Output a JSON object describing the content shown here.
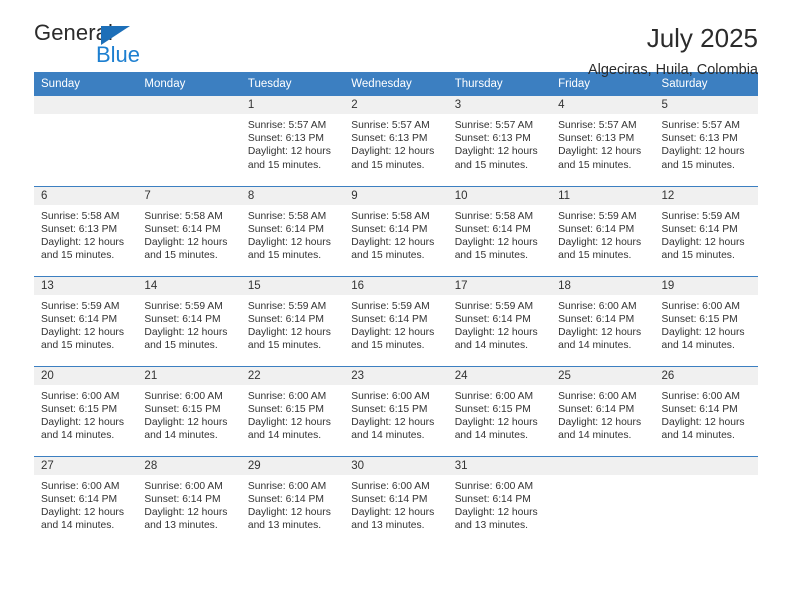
{
  "brand": {
    "name_top": "General",
    "name_bottom": "Blue",
    "triangle_color": "#1d6fb8",
    "blue_color": "#1d7fd0"
  },
  "header": {
    "month_title": "July 2025",
    "location": "Algeciras, Huila, Colombia"
  },
  "theme": {
    "header_blue": "#3c7fc1",
    "daynum_band": "#f0f0f0",
    "text": "#333333"
  },
  "weekdays": [
    "Sunday",
    "Monday",
    "Tuesday",
    "Wednesday",
    "Thursday",
    "Friday",
    "Saturday"
  ],
  "labels": {
    "sunrise_prefix": "Sunrise:",
    "sunset_prefix": "Sunset:",
    "daylight_prefix": "Daylight:"
  },
  "weeks": [
    [
      {
        "day": "",
        "blank": true
      },
      {
        "day": "",
        "blank": true
      },
      {
        "day": "1",
        "sunrise": "Sunrise: 5:57 AM",
        "sunset": "Sunset: 6:13 PM",
        "daylight1": "Daylight: 12 hours",
        "daylight2": "and 15 minutes."
      },
      {
        "day": "2",
        "sunrise": "Sunrise: 5:57 AM",
        "sunset": "Sunset: 6:13 PM",
        "daylight1": "Daylight: 12 hours",
        "daylight2": "and 15 minutes."
      },
      {
        "day": "3",
        "sunrise": "Sunrise: 5:57 AM",
        "sunset": "Sunset: 6:13 PM",
        "daylight1": "Daylight: 12 hours",
        "daylight2": "and 15 minutes."
      },
      {
        "day": "4",
        "sunrise": "Sunrise: 5:57 AM",
        "sunset": "Sunset: 6:13 PM",
        "daylight1": "Daylight: 12 hours",
        "daylight2": "and 15 minutes."
      },
      {
        "day": "5",
        "sunrise": "Sunrise: 5:57 AM",
        "sunset": "Sunset: 6:13 PM",
        "daylight1": "Daylight: 12 hours",
        "daylight2": "and 15 minutes."
      }
    ],
    [
      {
        "day": "6",
        "sunrise": "Sunrise: 5:58 AM",
        "sunset": "Sunset: 6:13 PM",
        "daylight1": "Daylight: 12 hours",
        "daylight2": "and 15 minutes."
      },
      {
        "day": "7",
        "sunrise": "Sunrise: 5:58 AM",
        "sunset": "Sunset: 6:14 PM",
        "daylight1": "Daylight: 12 hours",
        "daylight2": "and 15 minutes."
      },
      {
        "day": "8",
        "sunrise": "Sunrise: 5:58 AM",
        "sunset": "Sunset: 6:14 PM",
        "daylight1": "Daylight: 12 hours",
        "daylight2": "and 15 minutes."
      },
      {
        "day": "9",
        "sunrise": "Sunrise: 5:58 AM",
        "sunset": "Sunset: 6:14 PM",
        "daylight1": "Daylight: 12 hours",
        "daylight2": "and 15 minutes."
      },
      {
        "day": "10",
        "sunrise": "Sunrise: 5:58 AM",
        "sunset": "Sunset: 6:14 PM",
        "daylight1": "Daylight: 12 hours",
        "daylight2": "and 15 minutes."
      },
      {
        "day": "11",
        "sunrise": "Sunrise: 5:59 AM",
        "sunset": "Sunset: 6:14 PM",
        "daylight1": "Daylight: 12 hours",
        "daylight2": "and 15 minutes."
      },
      {
        "day": "12",
        "sunrise": "Sunrise: 5:59 AM",
        "sunset": "Sunset: 6:14 PM",
        "daylight1": "Daylight: 12 hours",
        "daylight2": "and 15 minutes."
      }
    ],
    [
      {
        "day": "13",
        "sunrise": "Sunrise: 5:59 AM",
        "sunset": "Sunset: 6:14 PM",
        "daylight1": "Daylight: 12 hours",
        "daylight2": "and 15 minutes."
      },
      {
        "day": "14",
        "sunrise": "Sunrise: 5:59 AM",
        "sunset": "Sunset: 6:14 PM",
        "daylight1": "Daylight: 12 hours",
        "daylight2": "and 15 minutes."
      },
      {
        "day": "15",
        "sunrise": "Sunrise: 5:59 AM",
        "sunset": "Sunset: 6:14 PM",
        "daylight1": "Daylight: 12 hours",
        "daylight2": "and 15 minutes."
      },
      {
        "day": "16",
        "sunrise": "Sunrise: 5:59 AM",
        "sunset": "Sunset: 6:14 PM",
        "daylight1": "Daylight: 12 hours",
        "daylight2": "and 15 minutes."
      },
      {
        "day": "17",
        "sunrise": "Sunrise: 5:59 AM",
        "sunset": "Sunset: 6:14 PM",
        "daylight1": "Daylight: 12 hours",
        "daylight2": "and 14 minutes."
      },
      {
        "day": "18",
        "sunrise": "Sunrise: 6:00 AM",
        "sunset": "Sunset: 6:14 PM",
        "daylight1": "Daylight: 12 hours",
        "daylight2": "and 14 minutes."
      },
      {
        "day": "19",
        "sunrise": "Sunrise: 6:00 AM",
        "sunset": "Sunset: 6:15 PM",
        "daylight1": "Daylight: 12 hours",
        "daylight2": "and 14 minutes."
      }
    ],
    [
      {
        "day": "20",
        "sunrise": "Sunrise: 6:00 AM",
        "sunset": "Sunset: 6:15 PM",
        "daylight1": "Daylight: 12 hours",
        "daylight2": "and 14 minutes."
      },
      {
        "day": "21",
        "sunrise": "Sunrise: 6:00 AM",
        "sunset": "Sunset: 6:15 PM",
        "daylight1": "Daylight: 12 hours",
        "daylight2": "and 14 minutes."
      },
      {
        "day": "22",
        "sunrise": "Sunrise: 6:00 AM",
        "sunset": "Sunset: 6:15 PM",
        "daylight1": "Daylight: 12 hours",
        "daylight2": "and 14 minutes."
      },
      {
        "day": "23",
        "sunrise": "Sunrise: 6:00 AM",
        "sunset": "Sunset: 6:15 PM",
        "daylight1": "Daylight: 12 hours",
        "daylight2": "and 14 minutes."
      },
      {
        "day": "24",
        "sunrise": "Sunrise: 6:00 AM",
        "sunset": "Sunset: 6:15 PM",
        "daylight1": "Daylight: 12 hours",
        "daylight2": "and 14 minutes."
      },
      {
        "day": "25",
        "sunrise": "Sunrise: 6:00 AM",
        "sunset": "Sunset: 6:14 PM",
        "daylight1": "Daylight: 12 hours",
        "daylight2": "and 14 minutes."
      },
      {
        "day": "26",
        "sunrise": "Sunrise: 6:00 AM",
        "sunset": "Sunset: 6:14 PM",
        "daylight1": "Daylight: 12 hours",
        "daylight2": "and 14 minutes."
      }
    ],
    [
      {
        "day": "27",
        "sunrise": "Sunrise: 6:00 AM",
        "sunset": "Sunset: 6:14 PM",
        "daylight1": "Daylight: 12 hours",
        "daylight2": "and 14 minutes."
      },
      {
        "day": "28",
        "sunrise": "Sunrise: 6:00 AM",
        "sunset": "Sunset: 6:14 PM",
        "daylight1": "Daylight: 12 hours",
        "daylight2": "and 13 minutes."
      },
      {
        "day": "29",
        "sunrise": "Sunrise: 6:00 AM",
        "sunset": "Sunset: 6:14 PM",
        "daylight1": "Daylight: 12 hours",
        "daylight2": "and 13 minutes."
      },
      {
        "day": "30",
        "sunrise": "Sunrise: 6:00 AM",
        "sunset": "Sunset: 6:14 PM",
        "daylight1": "Daylight: 12 hours",
        "daylight2": "and 13 minutes."
      },
      {
        "day": "31",
        "sunrise": "Sunrise: 6:00 AM",
        "sunset": "Sunset: 6:14 PM",
        "daylight1": "Daylight: 12 hours",
        "daylight2": "and 13 minutes."
      },
      {
        "day": "",
        "blank": true
      },
      {
        "day": "",
        "blank": true
      }
    ]
  ]
}
